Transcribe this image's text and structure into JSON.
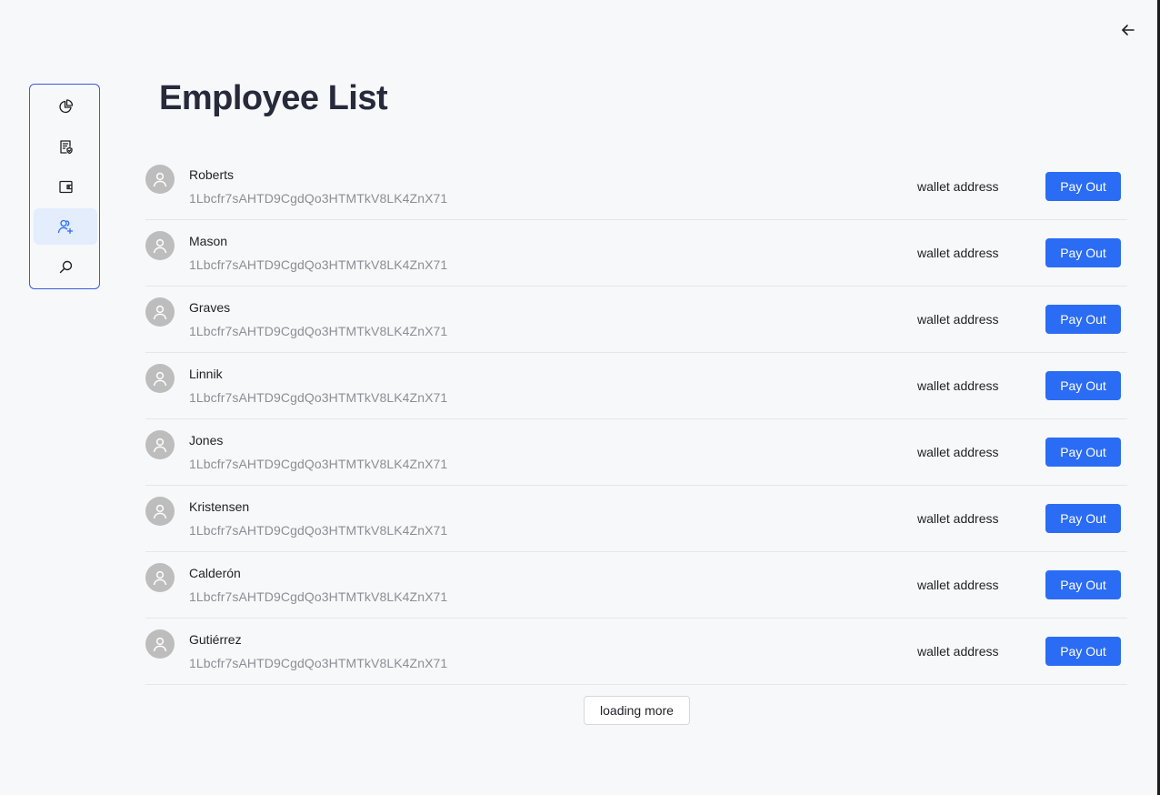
{
  "header": {
    "title": "Employee List",
    "back_icon": "arrow-left-icon"
  },
  "sidebar": {
    "items": [
      {
        "icon": "pie-chart-icon",
        "active": false
      },
      {
        "icon": "document-check-icon",
        "active": false
      },
      {
        "icon": "wallet-icon",
        "active": false
      },
      {
        "icon": "users-add-icon",
        "active": true
      },
      {
        "icon": "search-icon",
        "active": false
      }
    ],
    "accent_color": "#3b5bdb",
    "active_bg": "#e3edfc"
  },
  "employees": [
    {
      "name": "Roberts",
      "address": "1Lbcfr7sAHTD9CgdQo3HTMTkV8LK4ZnX71",
      "wallet_label": "wallet address",
      "action_label": "Pay Out"
    },
    {
      "name": "Mason",
      "address": "1Lbcfr7sAHTD9CgdQo3HTMTkV8LK4ZnX71",
      "wallet_label": "wallet address",
      "action_label": "Pay Out"
    },
    {
      "name": "Graves",
      "address": "1Lbcfr7sAHTD9CgdQo3HTMTkV8LK4ZnX71",
      "wallet_label": "wallet address",
      "action_label": "Pay Out"
    },
    {
      "name": "Linnik",
      "address": "1Lbcfr7sAHTD9CgdQo3HTMTkV8LK4ZnX71",
      "wallet_label": "wallet address",
      "action_label": "Pay Out"
    },
    {
      "name": "Jones",
      "address": "1Lbcfr7sAHTD9CgdQo3HTMTkV8LK4ZnX71",
      "wallet_label": "wallet address",
      "action_label": "Pay Out"
    },
    {
      "name": "Kristensen",
      "address": "1Lbcfr7sAHTD9CgdQo3HTMTkV8LK4ZnX71",
      "wallet_label": "wallet address",
      "action_label": "Pay Out"
    },
    {
      "name": "Calderón",
      "address": "1Lbcfr7sAHTD9CgdQo3HTMTkV8LK4ZnX71",
      "wallet_label": "wallet address",
      "action_label": "Pay Out"
    },
    {
      "name": "Gutiérrez",
      "address": "1Lbcfr7sAHTD9CgdQo3HTMTkV8LK4ZnX71",
      "wallet_label": "wallet address",
      "action_label": "Pay Out"
    }
  ],
  "load_more_label": "loading more",
  "colors": {
    "primary": "#2b6cf5",
    "background": "#f7f8fa",
    "avatar": "#bdbdbd"
  }
}
